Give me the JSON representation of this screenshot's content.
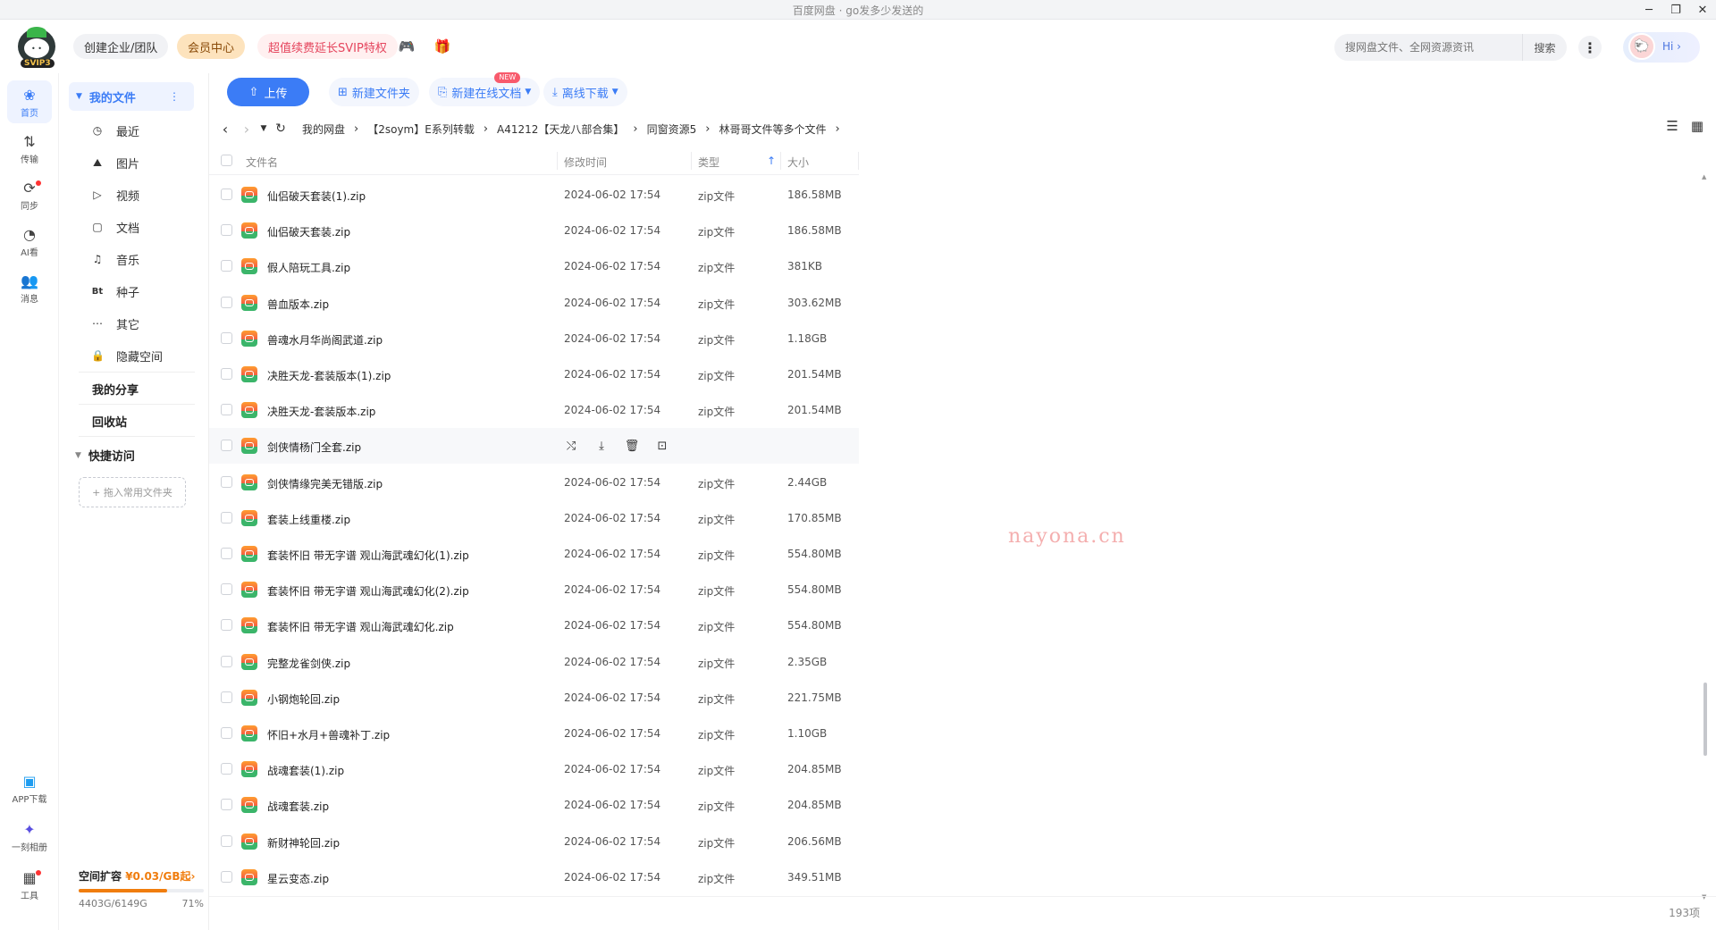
{
  "window": {
    "title": "百度网盘 · go发多少发送的"
  },
  "header": {
    "logo_badge": "SVIP3",
    "create_team": "创建企业/团队",
    "member_center": "会员中心",
    "svip_promo": "超值续费延长SVIP特权",
    "search_placeholder": "搜网盘文件、全网资源资讯",
    "search_button": "搜索",
    "greeting": "Hi"
  },
  "rail": [
    {
      "label": "首页",
      "icon": "home-icon"
    },
    {
      "label": "传输",
      "icon": "transfer-icon"
    },
    {
      "label": "同步",
      "icon": "sync-icon"
    },
    {
      "label": "AI看",
      "icon": "ai-icon"
    },
    {
      "label": "消息",
      "icon": "message-icon"
    },
    {
      "label": "APP下载",
      "icon": "phone-icon"
    },
    {
      "label": "一刻相册",
      "icon": "album-icon"
    },
    {
      "label": "工具",
      "icon": "tools-icon"
    }
  ],
  "nav": {
    "my_files": "我的文件",
    "items": [
      {
        "label": "最近",
        "icon": "clock-icon"
      },
      {
        "label": "图片",
        "icon": "image-icon"
      },
      {
        "label": "视频",
        "icon": "video-icon"
      },
      {
        "label": "文档",
        "icon": "document-icon"
      },
      {
        "label": "音乐",
        "icon": "music-icon"
      },
      {
        "label": "种子",
        "icon": "bt-icon"
      },
      {
        "label": "其它",
        "icon": "more-icon"
      },
      {
        "label": "隐藏空间",
        "icon": "lock-icon"
      }
    ],
    "my_share": "我的分享",
    "recycle": "回收站",
    "quick_access": "快捷访问",
    "drop_hint": "+ 拖入常用文件夹",
    "storage": {
      "label": "空间扩容",
      "price": "¥0.03/GB起",
      "used": "4403G/6149G",
      "percent_text": "71%",
      "percent": 71
    }
  },
  "toolbar": {
    "upload": "上传",
    "new_folder": "新建文件夹",
    "new_doc": "新建在线文档",
    "new_badge": "NEW",
    "offline_download": "离线下载"
  },
  "breadcrumb": [
    "我的网盘",
    "【2soym】E系列转载",
    "A41212【天龙八部合集】",
    "同窗资源5",
    "林哥哥文件等多个文件"
  ],
  "table": {
    "headers": {
      "name": "文件名",
      "date": "修改时间",
      "type": "类型",
      "size": "大小"
    },
    "rows": [
      {
        "name": "仙侣破天套装(1).zip",
        "date": "2024-06-02 17:54",
        "type": "zip文件",
        "size": "186.58MB"
      },
      {
        "name": "仙侣破天套装.zip",
        "date": "2024-06-02 17:54",
        "type": "zip文件",
        "size": "186.58MB"
      },
      {
        "name": "假人陪玩工具.zip",
        "date": "2024-06-02 17:54",
        "type": "zip文件",
        "size": "381KB"
      },
      {
        "name": "兽血版本.zip",
        "date": "2024-06-02 17:54",
        "type": "zip文件",
        "size": "303.62MB"
      },
      {
        "name": "兽魂水月华尚阁武道.zip",
        "date": "2024-06-02 17:54",
        "type": "zip文件",
        "size": "1.18GB"
      },
      {
        "name": "决胜天龙-套装版本(1).zip",
        "date": "2024-06-02 17:54",
        "type": "zip文件",
        "size": "201.54MB"
      },
      {
        "name": "决胜天龙-套装版本.zip",
        "date": "2024-06-02 17:54",
        "type": "zip文件",
        "size": "201.54MB"
      },
      {
        "name": "剑侠情杨门全套.zip",
        "date": "",
        "type": "",
        "size": ""
      },
      {
        "name": "剑侠情缘完美无错版.zip",
        "date": "2024-06-02 17:54",
        "type": "zip文件",
        "size": "2.44GB"
      },
      {
        "name": "套装上线重楼.zip",
        "date": "2024-06-02 17:54",
        "type": "zip文件",
        "size": "170.85MB"
      },
      {
        "name": "套装怀旧 带无字谱 观山海武魂幻化(1).zip",
        "date": "2024-06-02 17:54",
        "type": "zip文件",
        "size": "554.80MB"
      },
      {
        "name": "套装怀旧 带无字谱 观山海武魂幻化(2).zip",
        "date": "2024-06-02 17:54",
        "type": "zip文件",
        "size": "554.80MB"
      },
      {
        "name": "套装怀旧 带无字谱 观山海武魂幻化.zip",
        "date": "2024-06-02 17:54",
        "type": "zip文件",
        "size": "554.80MB"
      },
      {
        "name": "完整龙雀剑侠.zip",
        "date": "2024-06-02 17:54",
        "type": "zip文件",
        "size": "2.35GB"
      },
      {
        "name": "小钢炮轮回.zip",
        "date": "2024-06-02 17:54",
        "type": "zip文件",
        "size": "221.75MB"
      },
      {
        "name": "怀旧+水月+兽魂补丁.zip",
        "date": "2024-06-02 17:54",
        "type": "zip文件",
        "size": "1.10GB"
      },
      {
        "name": "战魂套装(1).zip",
        "date": "2024-06-02 17:54",
        "type": "zip文件",
        "size": "204.85MB"
      },
      {
        "name": "战魂套装.zip",
        "date": "2024-06-02 17:54",
        "type": "zip文件",
        "size": "204.85MB"
      },
      {
        "name": "新财神轮回.zip",
        "date": "2024-06-02 17:54",
        "type": "zip文件",
        "size": "206.56MB"
      },
      {
        "name": "星云变态.zip",
        "date": "2024-06-02 17:54",
        "type": "zip文件",
        "size": "349.51MB"
      }
    ],
    "hover_row_index": 7,
    "hover_actions": [
      "share-icon",
      "download-icon",
      "delete-icon",
      "more-actions-icon"
    ]
  },
  "watermark": "nayona.cn",
  "status": {
    "count": "193项"
  },
  "colors": {
    "accent": "#3b7cf6",
    "storage": "#f07d0e"
  }
}
